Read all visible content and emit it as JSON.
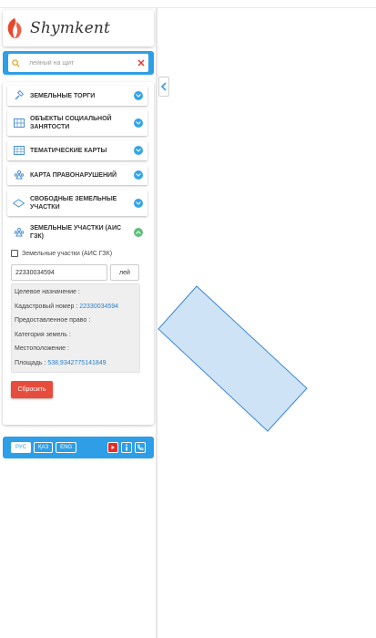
{
  "brand": {
    "logo_text": "Shymkent"
  },
  "search": {
    "placeholder": "лейный на щит"
  },
  "layers": [
    {
      "label": "Земельные торги",
      "icon": "auction-gavel-icon"
    },
    {
      "label": "Объекты социальной занятости",
      "icon": "building-grid-icon"
    },
    {
      "label": "Тематические карты",
      "icon": "map-grid-icon"
    },
    {
      "label": "Карта правонарушений",
      "icon": "people-group-icon"
    },
    {
      "label": "Свободные земельные участки",
      "icon": "land-plot-icon"
    },
    {
      "label": "Земельные участки (АИС ГЗК)",
      "icon": "people-group-icon",
      "open": true
    }
  ],
  "land_plots": {
    "checkbox_label": "Земельные участки (АИС ГЗК)",
    "query_value": "22330034594",
    "query_button": "лей",
    "fields": {
      "purpose_label": "Целевое назначение :",
      "purpose_value": "",
      "cadastral_label": "Кадастровый номер : ",
      "cadastral_value": "22330034594",
      "right_label": "Предоставленное право :",
      "right_value": "",
      "category_label": "Категория земель :",
      "category_value": "",
      "location_label": "Местоположение :",
      "location_value": "",
      "area_label": "Площадь : ",
      "area_value": "538,9342775141849"
    },
    "reset_button": "Сбросить"
  },
  "footer": {
    "languages": [
      "РУС",
      "ҚАЗ",
      "ENG"
    ],
    "active_language": "РУС"
  },
  "colors": {
    "accent": "#2e9ee6",
    "toggle": "#33a5e8",
    "toggle_open": "#5cbf7a",
    "reset": "#e74c3c",
    "plot_fill": "#cfe3f7",
    "plot_stroke": "#3b87d6"
  }
}
